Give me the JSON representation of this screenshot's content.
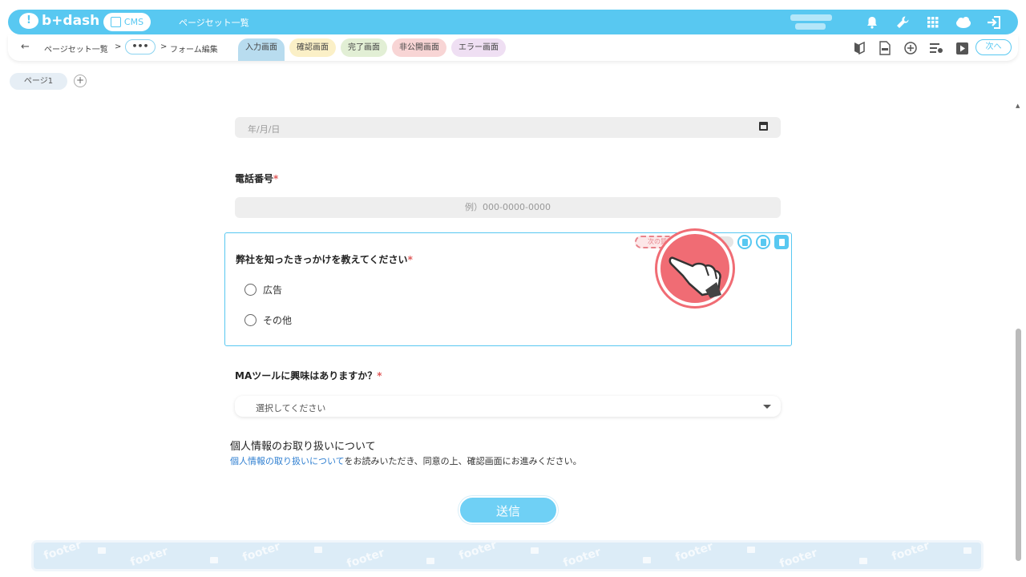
{
  "header": {
    "logo_text": "b+dash",
    "logo_mark": "!",
    "cms_label": "CMS",
    "title": "ページセット一覧",
    "icons": [
      "bell-icon",
      "wrench-icon",
      "grid-icon",
      "cloud-icon",
      "logout-icon"
    ]
  },
  "subbar": {
    "back_arrow": "←",
    "breadcrumb_1": "ページセット一覧",
    "sep": ">",
    "more": "•••",
    "breadcrumb_2": "フォーム編集",
    "tabs": [
      {
        "label": "入力画面"
      },
      {
        "label": "確認画面"
      },
      {
        "label": "完了画面"
      },
      {
        "label": "非公開画面"
      },
      {
        "label": "エラー画面"
      }
    ],
    "tool_icons": [
      "beginner-mark-icon",
      "html-file-icon",
      "plus-circle-icon",
      "settings-list-icon",
      "play-icon"
    ],
    "next_label": "次へ"
  },
  "pages": {
    "page_tab": "ページ1",
    "add": "+"
  },
  "form": {
    "date_placeholder": "年/月/日",
    "tel_label": "電話番号",
    "tel_placeholder": "例）000-0000-0000",
    "required_mark": "*",
    "question_label": "弊社を知ったきっかけを教えてください",
    "show_next_question": "次の質問を表示",
    "options": [
      "広告",
      "その他"
    ],
    "ma_label": "MAツールに興味はありますか？",
    "select_value": "選択してください",
    "privacy_title": "個人情報のお取り扱いについて",
    "privacy_link": "個人情報の取り扱いについて",
    "privacy_text": "をお読みいただき、同意の上、確認画面にお進みください。",
    "submit_label": "送信"
  },
  "footer": {
    "watermark": "footer"
  },
  "colors": {
    "accent": "#58c8f1",
    "required": "#e05a5a",
    "highlight": "#f06c74"
  }
}
